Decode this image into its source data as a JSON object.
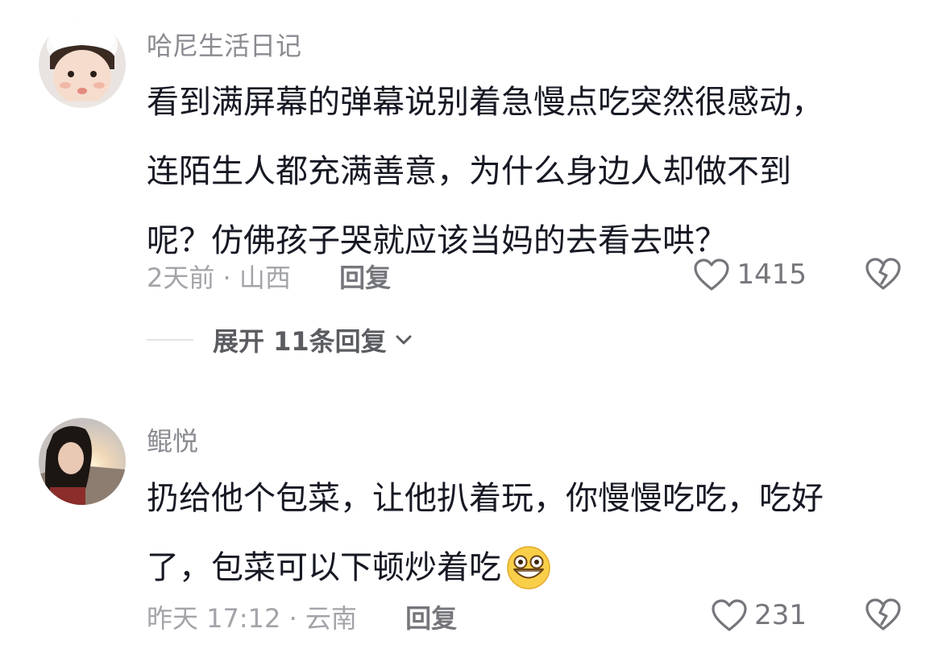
{
  "comments": [
    {
      "username": "哈尼生活日记",
      "text_lines": [
        "看到满屏幕的弹幕说别着急慢点吃突然很感动，",
        "连陌生人都充满善意，为什么身边人却做不到",
        "呢？仿佛孩子哭就应该当妈的去看去哄？"
      ],
      "time_location": "2天前 · 山西",
      "reply_label": "回复",
      "like_count": "1415",
      "expand_replies_label": "展开 11条回复"
    },
    {
      "username": "鲲悦",
      "text_lines": [
        "扔给他个包菜，让他扒着玩，你慢慢吃吃，吃好",
        "了，包菜可以下顿炒着吃"
      ],
      "emoji": "grinning-face-emoji",
      "time_location": "昨天 17:12 · 云南",
      "reply_label": "回复",
      "like_count": "231"
    }
  ],
  "icons": {
    "like": "heart-outline-icon",
    "dislike": "broken-heart-outline-icon",
    "expand": "chevron-down-icon"
  },
  "colors": {
    "username": "#8a8b91",
    "body_text": "#161823",
    "meta_text": "#a3a4a9",
    "secondary_text": "#75767b"
  }
}
